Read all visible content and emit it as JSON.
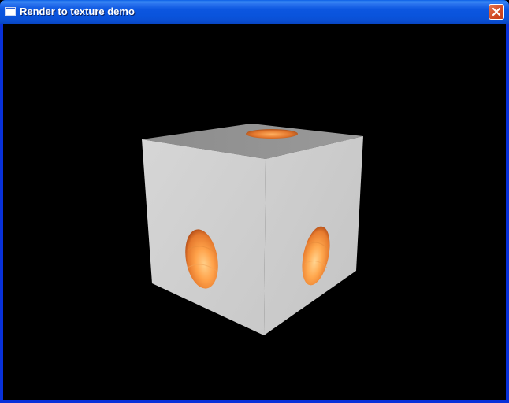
{
  "window": {
    "title": "Render to texture demo",
    "icon": "application-window-icon",
    "close_icon": "close-x-icon"
  },
  "viewport": {
    "background": "#000000",
    "scene": "white cube textured with orange spheres",
    "cube_color": "#d0d0d0",
    "sphere_color": "#ff9a3c"
  }
}
